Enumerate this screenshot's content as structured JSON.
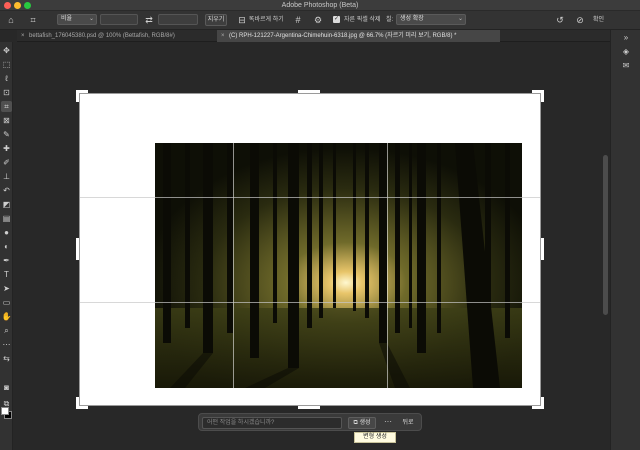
{
  "window": {
    "title": "Adobe Photoshop (Beta)"
  },
  "options_bar": {
    "crop_icon": "crop-icon",
    "ratio_select": "비율",
    "swap_icon": "swap-icon",
    "clear_button": "지우기",
    "straighten_button": "똑바르게 하기",
    "delete_cropped_label": "자른 픽셀 삭제",
    "fill_label": "칠:",
    "fill_select": "생성 확장",
    "reset_icon": "reset-icon",
    "cancel_icon": "cancel-icon",
    "confirm_button": "확인"
  },
  "tabs": [
    {
      "label": "bettafish_176045380.psd @ 100% (Bettafish, RGB/8#)",
      "active": false
    },
    {
      "label": "(C) RPH-121227-Argentina-Chimehuin-6318.jpg @ 66.7% (자르기 미리 보기, RGB/8) *",
      "active": true
    }
  ],
  "toolbar": {
    "tools": [
      "move-icon",
      "marquee-icon",
      "lasso-icon",
      "object-select-icon",
      "crop-icon",
      "frame-icon",
      "eyedropper-icon",
      "healing-icon",
      "brush-icon",
      "stamp-icon",
      "history-brush-icon",
      "eraser-icon",
      "gradient-icon",
      "blur-icon",
      "dodge-icon",
      "pen-icon",
      "type-icon",
      "path-select-icon",
      "rectangle-icon",
      "hand-icon",
      "zoom-icon",
      "more-icon"
    ]
  },
  "right_panel": {
    "icons": [
      "panel-toggle-icon",
      "layers-icon",
      "comment-icon"
    ]
  },
  "context_bar": {
    "prompt_placeholder": "어떤 작업을 하시겠습니까?",
    "generate_button": "생성",
    "more_label": "···",
    "back_button": "뒤로",
    "tooltip": "변형 생성"
  }
}
